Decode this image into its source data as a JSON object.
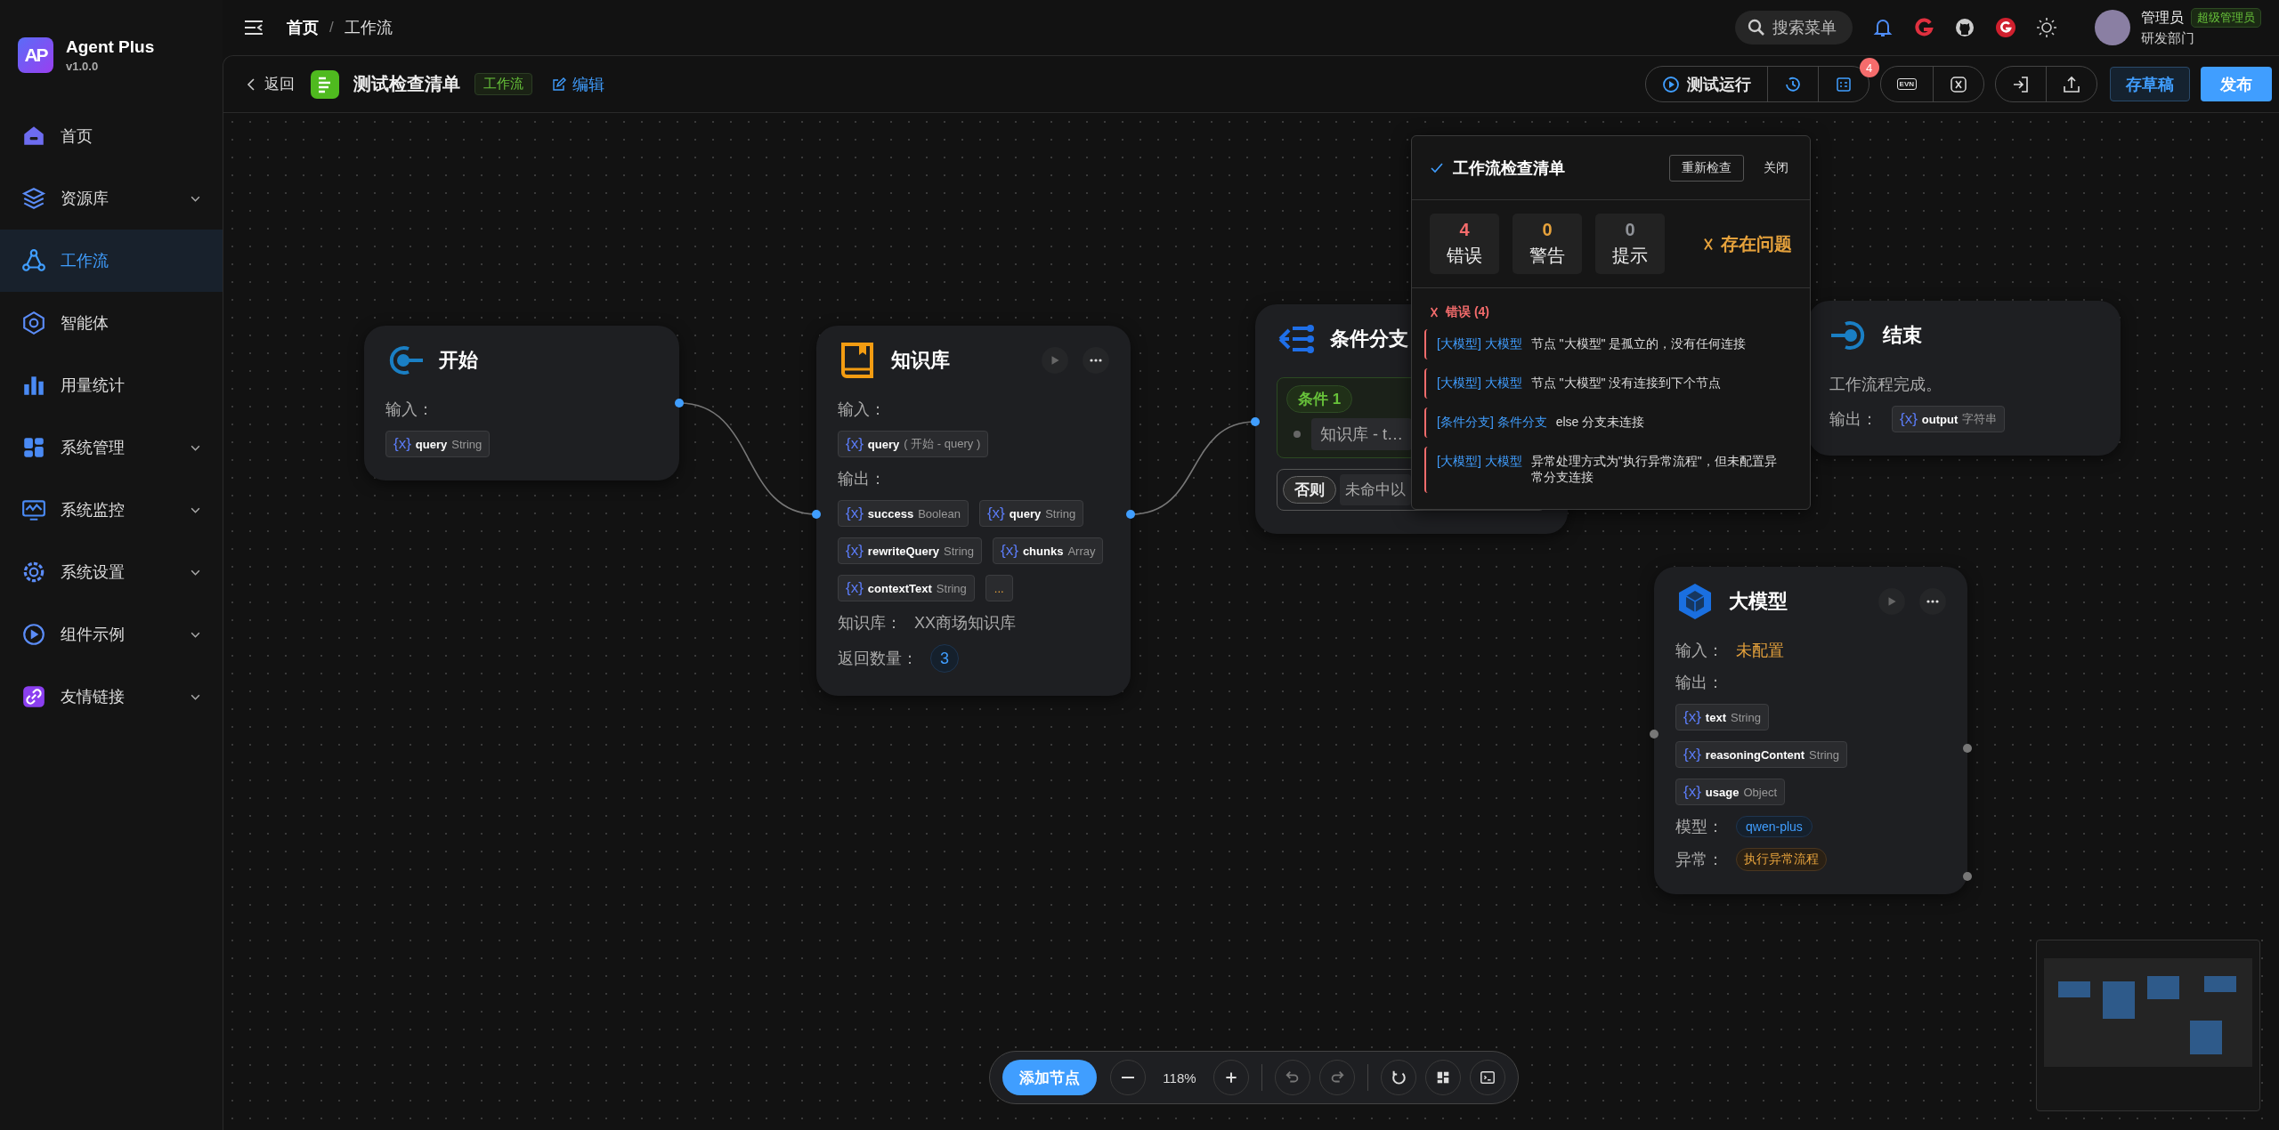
{
  "app": {
    "logo_text": "AP",
    "name": "Agent Plus",
    "version": "v1.0.0"
  },
  "sidebar": {
    "items": [
      {
        "label": "首页",
        "selected": false,
        "expandable": false
      },
      {
        "label": "资源库",
        "selected": false,
        "expandable": true
      },
      {
        "label": "工作流",
        "selected": true,
        "expandable": false
      },
      {
        "label": "智能体",
        "selected": false,
        "expandable": false
      },
      {
        "label": "用量统计",
        "selected": false,
        "expandable": false
      },
      {
        "label": "系统管理",
        "selected": false,
        "expandable": true
      },
      {
        "label": "系统监控",
        "selected": false,
        "expandable": true
      },
      {
        "label": "系统设置",
        "selected": false,
        "expandable": true
      },
      {
        "label": "组件示例",
        "selected": false,
        "expandable": true
      },
      {
        "label": "友情链接",
        "selected": false,
        "expandable": true
      }
    ]
  },
  "topbar": {
    "breadcrumb": [
      {
        "label": "首页",
        "current": false
      },
      {
        "label": "工作流",
        "current": true
      }
    ],
    "separator": "/",
    "search_placeholder": "搜索菜单",
    "user": {
      "name": "管理员",
      "role": "超级管理员",
      "department": "研发部门"
    }
  },
  "header": {
    "back": "返回",
    "title": "测试检查清单",
    "tag": "工作流",
    "edit": "编辑",
    "test_run": "测试运行",
    "checklist_badge": "4",
    "env_label": "EVN",
    "save_draft": "存草稿",
    "publish": "发布"
  },
  "nodes": [
    {
      "kind": "start",
      "title": "开始",
      "input_label": "输入：",
      "inputs": [
        {
          "icon": "{x}",
          "name": "query",
          "type": "String"
        }
      ]
    },
    {
      "kind": "knowledge",
      "title": "知识库",
      "input_label": "输入：",
      "inputs": [
        {
          "icon": "{x}",
          "name": "query",
          "type": "( 开始 - query )"
        }
      ],
      "output_label": "输出：",
      "outputs": [
        {
          "icon": "{x}",
          "name": "success",
          "type": "Boolean"
        },
        {
          "icon": "{x}",
          "name": "query",
          "type": "String"
        },
        {
          "icon": "{x}",
          "name": "rewriteQuery",
          "type": "String"
        },
        {
          "icon": "{x}",
          "name": "chunks",
          "type": "Array"
        },
        {
          "icon": "{x}",
          "name": "contextText",
          "type": "String"
        }
      ],
      "more": "...",
      "fields": [
        {
          "label": "知识库：",
          "value": "XX商场知识库"
        },
        {
          "label": "返回数量：",
          "value": "3"
        }
      ]
    },
    {
      "kind": "condition",
      "title": "条件分支",
      "branches": [
        {
          "kind": "case",
          "label": "条件 1",
          "text": "知识库 - t…"
        },
        {
          "kind": "else",
          "label": "否则",
          "text": "未命中以"
        }
      ]
    },
    {
      "kind": "end",
      "title": "结束",
      "description": "工作流程完成。",
      "output_label": "输出：",
      "outputs": [
        {
          "icon": "{x}",
          "name": "output",
          "type": "字符串"
        }
      ]
    },
    {
      "kind": "llm",
      "title": "大模型",
      "input_label": "输入：",
      "input_value": "未配置",
      "output_label": "输出：",
      "outputs": [
        {
          "icon": "{x}",
          "name": "text",
          "type": "String"
        },
        {
          "icon": "{x}",
          "name": "reasoningContent",
          "type": "String"
        },
        {
          "icon": "{x}",
          "name": "usage",
          "type": "Object"
        }
      ],
      "model_label": "模型：",
      "model": "qwen-plus",
      "error_label": "异常：",
      "error_mode": "执行异常流程"
    }
  ],
  "checklist": {
    "title": "工作流检查清单",
    "recheck": "重新检查",
    "close": "关闭",
    "stats": [
      {
        "kind": "error",
        "count": "4",
        "label": "错误"
      },
      {
        "kind": "warning",
        "count": "0",
        "label": "警告"
      },
      {
        "kind": "info",
        "count": "0",
        "label": "提示"
      }
    ],
    "status": "存在问题",
    "section": "错误 (4)",
    "issues": [
      {
        "source": "[大模型] 大模型",
        "message": "节点 \"大模型\" 是孤立的，没有任何连接"
      },
      {
        "source": "[大模型] 大模型",
        "message": "节点 \"大模型\" 没有连接到下个节点"
      },
      {
        "source": "[条件分支] 条件分支",
        "message": "else 分支未连接"
      },
      {
        "source": "[大模型] 大模型",
        "message": "异常处理方式为\"执行异常流程\"，但未配置异常分支连接"
      }
    ]
  },
  "toolbar": {
    "add_node": "添加节点",
    "zoom": "118%"
  }
}
